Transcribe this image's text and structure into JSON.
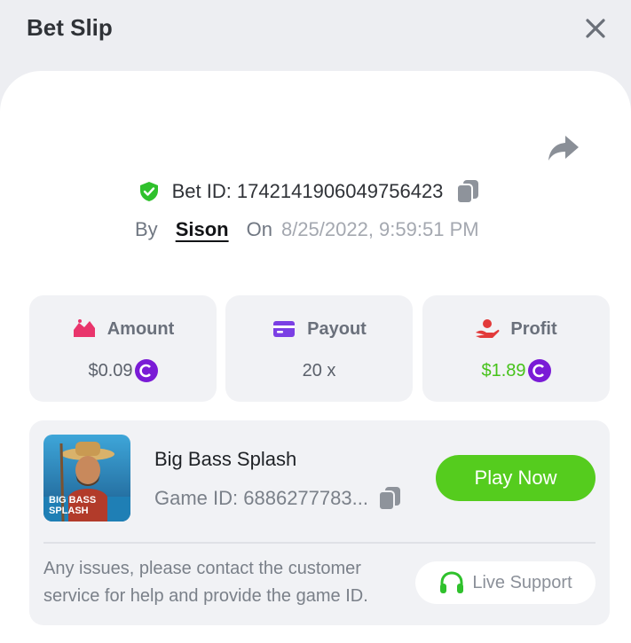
{
  "header": {
    "title": "Bet Slip",
    "close_icon": "close-icon"
  },
  "bet": {
    "id_label": "Bet ID: 1742141906049756423",
    "by_label": "By",
    "user": "Sison",
    "on_label": "On",
    "datetime": "8/25/2022, 9:59:51 PM"
  },
  "stats": {
    "amount": {
      "label": "Amount",
      "value": "$0.09",
      "icon": "money-icon"
    },
    "payout": {
      "label": "Payout",
      "value": "20 x",
      "icon": "card-icon"
    },
    "profit": {
      "label": "Profit",
      "value": "$1.89",
      "icon": "hand-coin-icon"
    }
  },
  "game": {
    "name": "Big Bass Splash",
    "id_label": "Game ID: 6886277783...",
    "thumbnail_text": [
      "BIG BASS",
      "SPLASH"
    ],
    "play_label": "Play Now"
  },
  "support": {
    "message": "Any issues, please contact the customer service for help and provide the game ID.",
    "button_label": "Live Support"
  },
  "colors": {
    "accent_green": "#55cc1e",
    "profit_green": "#46c21a",
    "coin_purple": "#7a1bd6",
    "amount_icon": "#e9356c",
    "payout_icon": "#7b3fe4",
    "profit_icon": "#e23a3a"
  }
}
